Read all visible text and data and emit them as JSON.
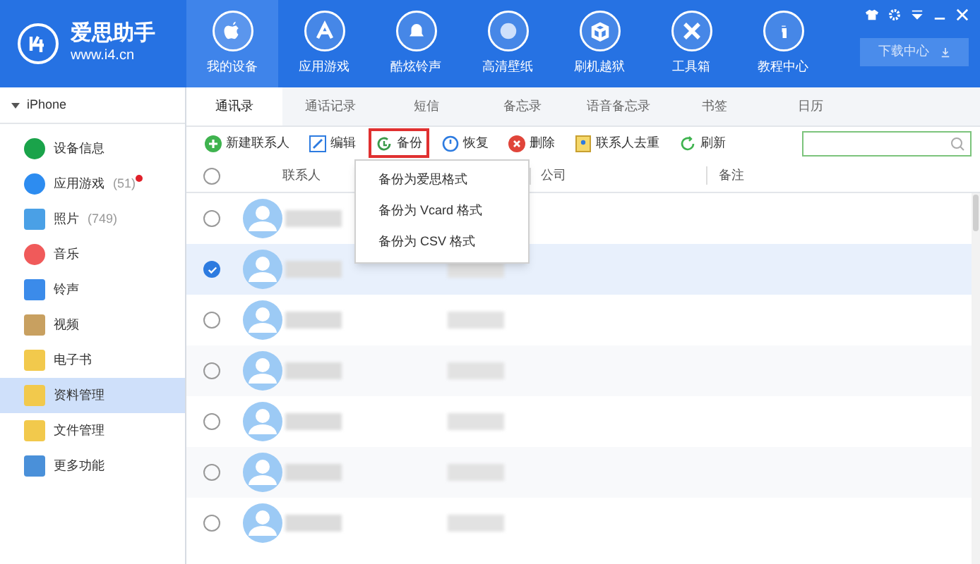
{
  "app": {
    "name": "爱思助手",
    "url": "www.i4.cn"
  },
  "nav": [
    {
      "label": "我的设备",
      "selected": true
    },
    {
      "label": "应用游戏",
      "selected": false
    },
    {
      "label": "酷炫铃声",
      "selected": false
    },
    {
      "label": "高清壁纸",
      "selected": false
    },
    {
      "label": "刷机越狱",
      "selected": false
    },
    {
      "label": "工具箱",
      "selected": false
    },
    {
      "label": "教程中心",
      "selected": false
    }
  ],
  "download_button": "下载中心",
  "device": {
    "name": "iPhone",
    "expanded": true
  },
  "sidebar": [
    {
      "label": "设备信息",
      "selected": false
    },
    {
      "label": "应用游戏",
      "count": "(51)",
      "badge": true,
      "selected": false
    },
    {
      "label": "照片",
      "count": "(749)",
      "selected": false
    },
    {
      "label": "音乐",
      "selected": false
    },
    {
      "label": "铃声",
      "selected": false
    },
    {
      "label": "视频",
      "selected": false
    },
    {
      "label": "电子书",
      "selected": false
    },
    {
      "label": "资料管理",
      "selected": true
    },
    {
      "label": "文件管理",
      "selected": false
    },
    {
      "label": "更多功能",
      "selected": false
    }
  ],
  "tabs": [
    {
      "label": "通讯录",
      "selected": true
    },
    {
      "label": "通话记录",
      "selected": false
    },
    {
      "label": "短信",
      "selected": false
    },
    {
      "label": "备忘录",
      "selected": false
    },
    {
      "label": "语音备忘录",
      "selected": false
    },
    {
      "label": "书签",
      "selected": false
    },
    {
      "label": "日历",
      "selected": false
    }
  ],
  "toolbar": [
    {
      "label": "新建联系人",
      "highlighted": false
    },
    {
      "label": "编辑",
      "highlighted": false
    },
    {
      "label": "备份",
      "highlighted": true
    },
    {
      "label": "恢复",
      "highlighted": false
    },
    {
      "label": "删除",
      "highlighted": false
    },
    {
      "label": "联系人去重",
      "highlighted": false
    },
    {
      "label": "刷新",
      "highlighted": false
    }
  ],
  "table": {
    "columns": [
      "联系人",
      "公司",
      "备注"
    ],
    "all_selected": false,
    "rows": [
      {
        "selected": false
      },
      {
        "selected": true
      },
      {
        "selected": false
      },
      {
        "selected": false
      },
      {
        "selected": false
      },
      {
        "selected": false
      },
      {
        "selected": false
      }
    ]
  },
  "backup_menu": [
    "备份为爱思格式",
    "备份为 Vcard 格式",
    "备份为 CSV 格式"
  ]
}
